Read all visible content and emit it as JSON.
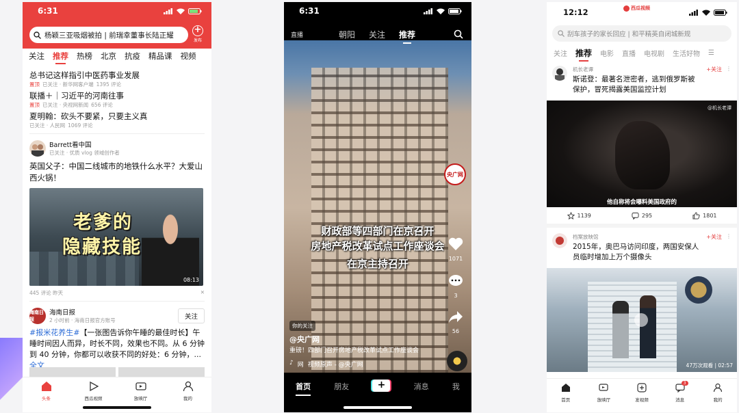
{
  "phone1": {
    "status": {
      "time": "6:31"
    },
    "search": {
      "text": "杨颖三亚吸烟被拍 | 前瑞幸董事长陆正耀"
    },
    "publish_label": "发布",
    "tabs": [
      "关注",
      "推荐",
      "热榜",
      "北京",
      "抗疫",
      "精品课",
      "视频"
    ],
    "active_tab": "推荐",
    "news": [
      {
        "title": "总书记这样指引中医药事业发展",
        "tag": "置顶",
        "source": "已关注 · 新华网客户端",
        "comments": "1395 评论"
      },
      {
        "title": "联播＋｜习近平的河南往事",
        "tag": "置顶",
        "source": "已关注 · 央视网新闻",
        "comments": "656 评论"
      },
      {
        "title": "夏明翰：砍头不要紧，只要主义真",
        "tag": "",
        "source": "已关注 · 人民网",
        "comments": "1069 评论"
      }
    ],
    "post": {
      "author": "Barrett看中国",
      "author_sub": "已关注 · 优质 vlog 领域创作者",
      "title": "英国父子：中国二线城市的地铁什么水平？大爱山西火锅！",
      "video_line1": "老爹的",
      "video_line2": "隐藏技能",
      "duration": "08:13",
      "meta": "445 评论  昨天"
    },
    "hainan": {
      "logo": "海南日报",
      "name": "海南日报",
      "sub": "2 小时前 · 海南日报官方账号",
      "follow": "关注",
      "hashtag": "#报米花养生#",
      "text": "【一张图告诉你午睡的最佳时长】午睡时间因人而异，时长不同，效果也不同。从 6 分钟到 40 分钟，你都可以收获不同的好处：6 分钟，...",
      "more": "全文"
    },
    "nav": [
      {
        "label": "头条",
        "icon": "home-icon"
      },
      {
        "label": "西瓜视频",
        "icon": "play-icon"
      },
      {
        "label": "放映厅",
        "icon": "tv-icon"
      },
      {
        "label": "我的",
        "icon": "user-icon"
      }
    ],
    "accent": "#e9413e"
  },
  "phone2": {
    "status": {
      "time": "6:31"
    },
    "live_label": "直播",
    "tabs": [
      "朝阳",
      "关注",
      "推荐"
    ],
    "active_tab": "推荐",
    "overlay_line1": "财政部等四部门在京召开",
    "overlay_line2": "房地产税改革试点工作座谈会",
    "overlay_line3": "在京主持召开",
    "logo": "央广网",
    "likes": "1071",
    "comments": "3",
    "shares": "56",
    "pill": "你的关注",
    "handle": "@央广网",
    "desc": "重磅！四部门召开房地产税改革试点工作座谈会",
    "music": "视频原声 - @央广网",
    "music_prefix": "网",
    "nav": [
      "首页",
      "朋友",
      "+",
      "消息",
      "我"
    ],
    "active_nav": "首页"
  },
  "phone3": {
    "status": {
      "time": "12:12"
    },
    "app_badge": "西瓜视频",
    "search": {
      "placeholder": "刮车孩子的家长回应 | 和平精英自闭城新规"
    },
    "tabs": [
      "关注",
      "推荐",
      "电影",
      "直播",
      "电视剧",
      "生活好物"
    ],
    "active_tab": "推荐",
    "card1": {
      "source": "机长老谭",
      "title": "斯诺登：最著名泄密者，逃到俄罗斯被保护，冒死揭露美国监控计划",
      "follow": "+关注",
      "watermark": "@机长老谭",
      "caption": "他自称将会曝料美国政府的",
      "likes": "1139",
      "comments": "295",
      "shares": "1801"
    },
    "card2": {
      "source": "档案放映馆",
      "title": "2015年，奥巴马访问印度，两国安保人员临时增加上万个摄像头",
      "follow": "+关注",
      "views": "47万次观看 | 02:57"
    },
    "nav": [
      {
        "label": "首页",
        "icon": "home-icon"
      },
      {
        "label": "放映厅",
        "icon": "tv-icon"
      },
      {
        "label": "发视频",
        "icon": "plus-icon"
      },
      {
        "label": "消息",
        "icon": "message-icon",
        "badge": "3"
      },
      {
        "label": "我的",
        "icon": "user-icon"
      }
    ],
    "accent": "#e43e3e"
  }
}
